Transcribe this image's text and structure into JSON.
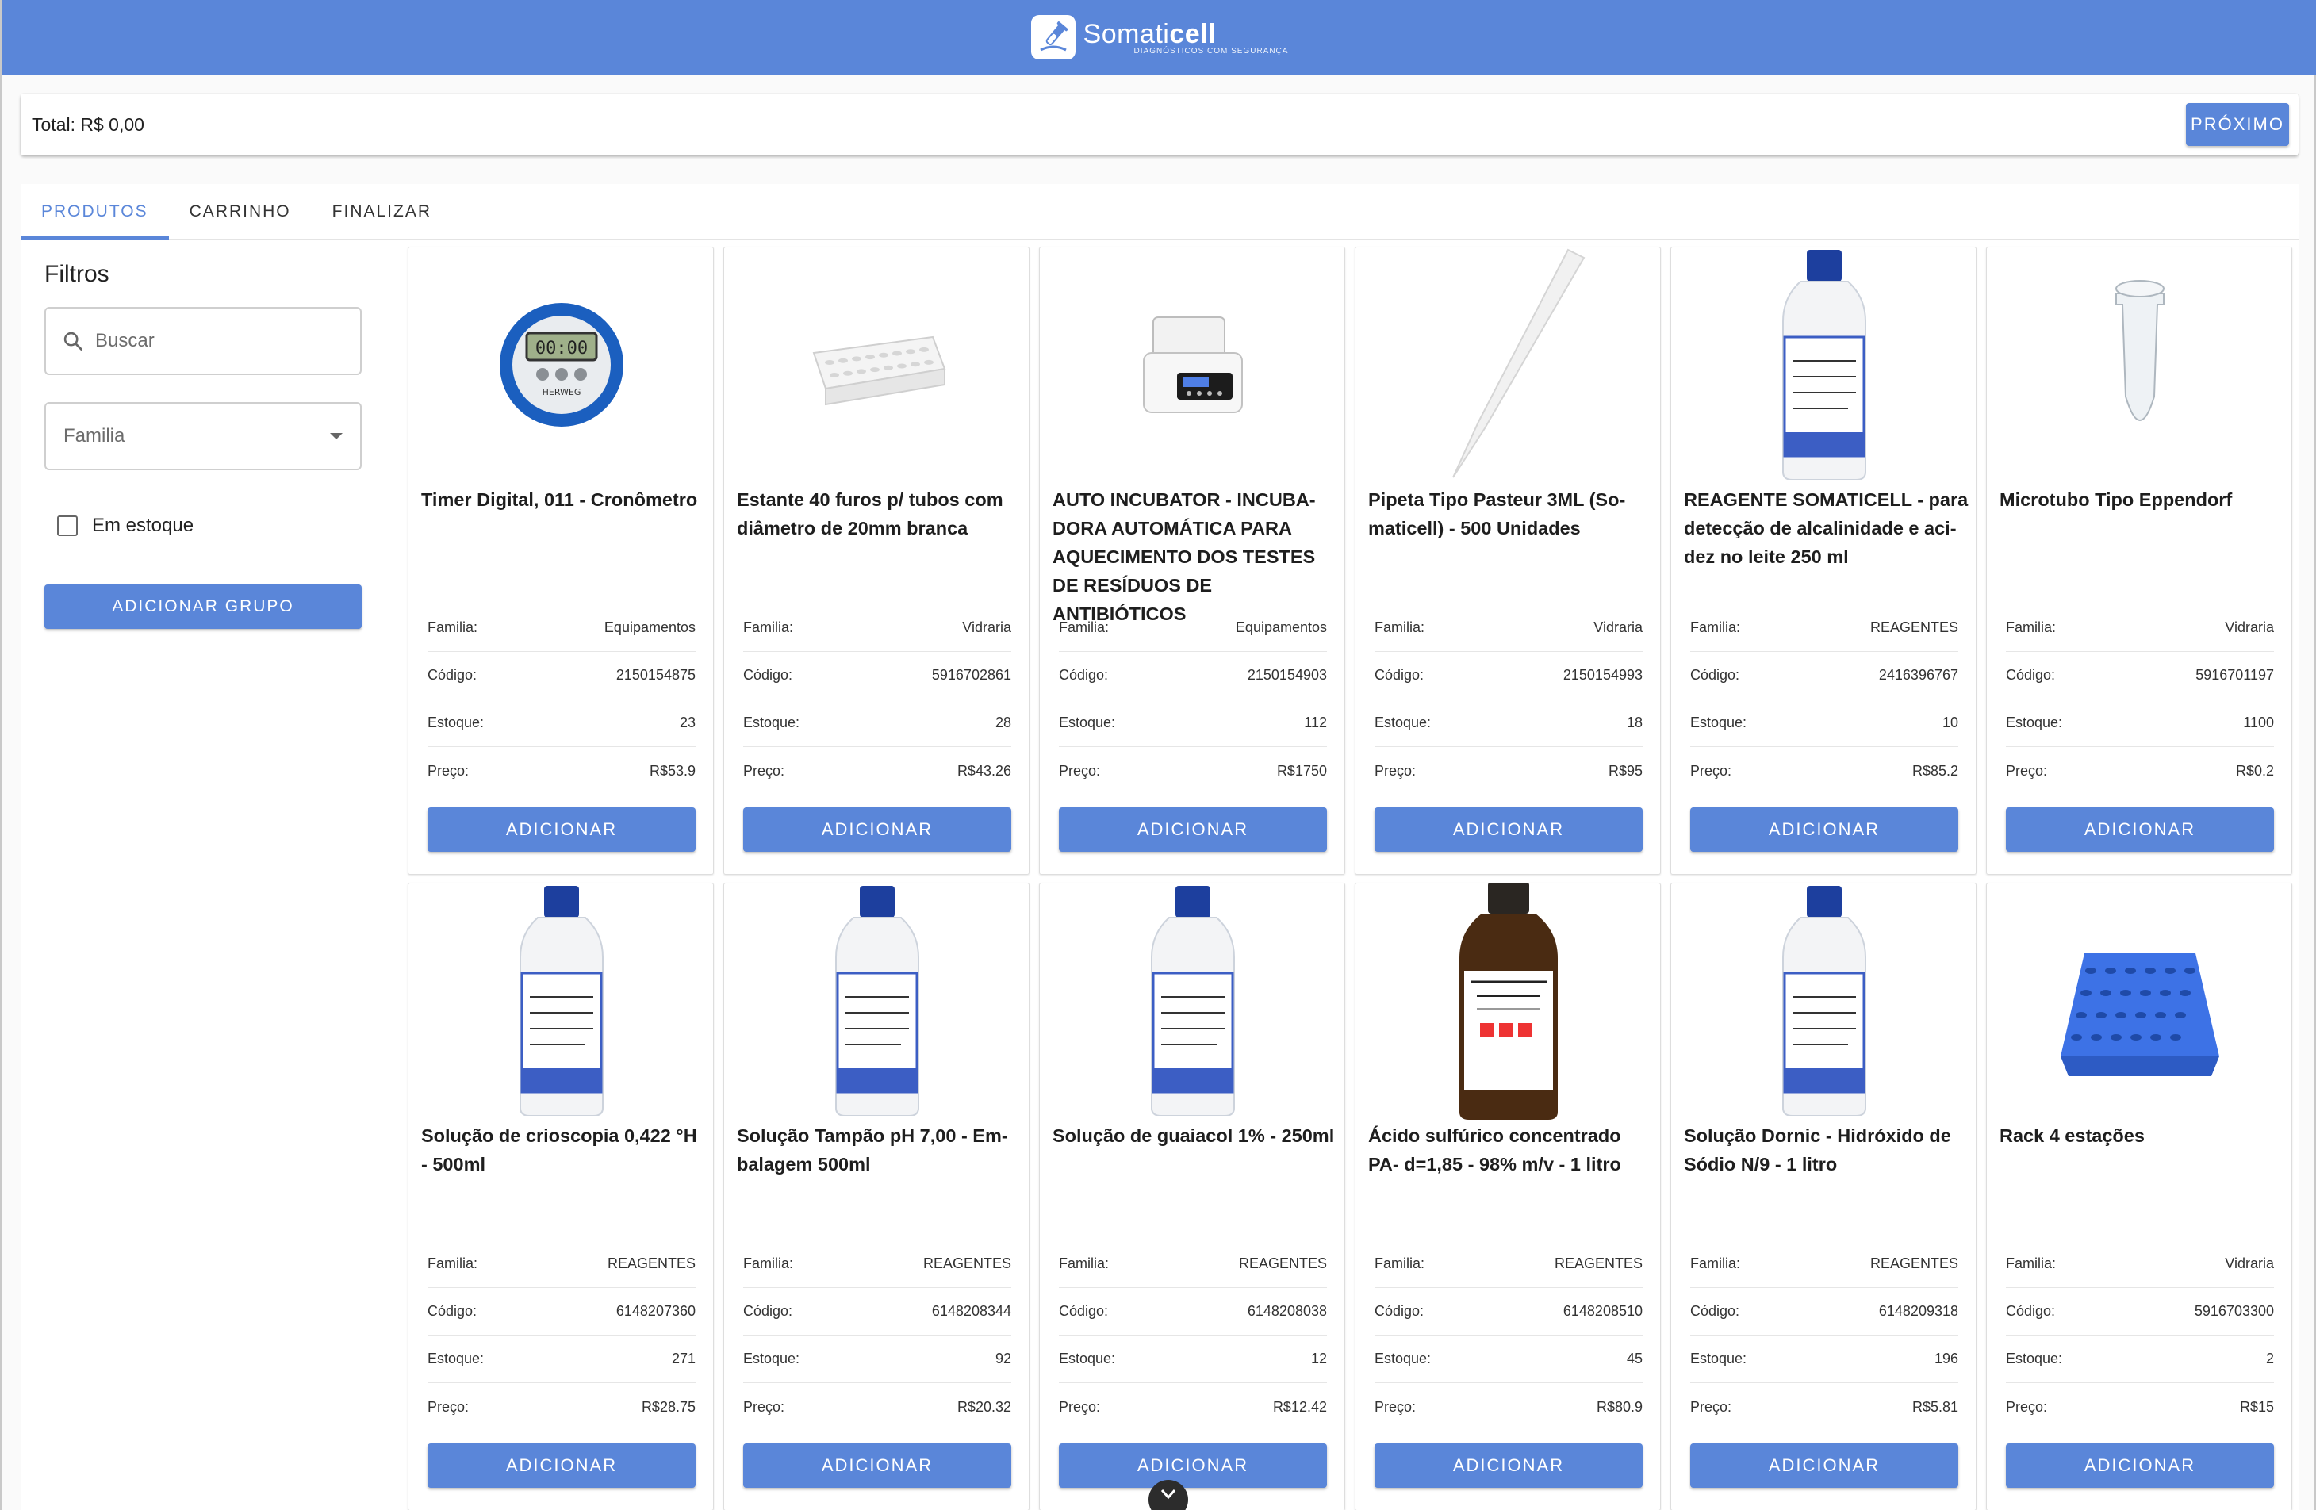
{
  "header": {
    "brand_name_light": "Somati",
    "brand_name_bold": "cell",
    "brand_tagline": "DIAGNÓSTICOS COM SEGURANÇA",
    "brand_color": "#5a86d9"
  },
  "totalbar": {
    "total_label": "Total: R$ 0,00",
    "next_button": "PRÓXIMO"
  },
  "tabs": [
    {
      "label": "PRODUTOS",
      "active": true
    },
    {
      "label": "CARRINHO",
      "active": false
    },
    {
      "label": "FINALIZAR",
      "active": false
    }
  ],
  "filters": {
    "title": "Filtros",
    "search_placeholder": "Buscar",
    "family_placeholder": "Familia",
    "in_stock_label": "Em estoque",
    "in_stock_checked": false,
    "add_group_button": "ADICIONAR GRUPO"
  },
  "labels": {
    "family": "Familia:",
    "code": "Código:",
    "stock": "Estoque:",
    "price": "Preço:",
    "add_button": "ADICIONAR"
  },
  "products": [
    {
      "title": "Timer Digital, 011 - Cronômetro",
      "family": "Equipamentos",
      "code": "2150154875",
      "stock": "23",
      "price": "R$53.9",
      "icon": "timer-icon"
    },
    {
      "title": "Estante 40 furos p/ tubos com diâmetro de 20mm branca",
      "family": "Vidraria",
      "code": "5916702861",
      "stock": "28",
      "price": "R$43.26",
      "icon": "tube-rack-icon"
    },
    {
      "title": "AUTO INCUBATOR - INCUBA-DORA AUTOMÁTICA PARA AQUECIMENTO DOS TESTES DE RESÍDUOS DE ANTIBIÓTICOS",
      "family": "Equipamentos",
      "code": "2150154903",
      "stock": "112",
      "price": "R$1750",
      "icon": "incubator-icon"
    },
    {
      "title": "Pipeta Tipo Pasteur 3ML (So-maticell) - 500 Unidades",
      "family": "Vidraria",
      "code": "2150154993",
      "stock": "18",
      "price": "R$95",
      "icon": "pipette-icon"
    },
    {
      "title": "REAGENTE SOMATICELL - para detecção de alcalinidade e aci-dez no leite 250 ml",
      "family": "REAGENTES",
      "code": "2416396767",
      "stock": "10",
      "price": "R$85.2",
      "icon": "bottle-icon"
    },
    {
      "title": "Microtubo Tipo Eppendorf",
      "family": "Vidraria",
      "code": "5916701197",
      "stock": "1100",
      "price": "R$0.2",
      "icon": "microtube-icon"
    },
    {
      "title": "Solução de crioscopia 0,422 °H - 500ml",
      "family": "REAGENTES",
      "code": "6148207360",
      "stock": "271",
      "price": "R$28.75",
      "icon": "bottle-icon"
    },
    {
      "title": "Solução Tampão pH 7,00 - Em-balagem 500ml",
      "family": "REAGENTES",
      "code": "6148208344",
      "stock": "92",
      "price": "R$20.32",
      "icon": "bottle-icon"
    },
    {
      "title": "Solução de guaiacol 1% - 250ml",
      "family": "REAGENTES",
      "code": "6148208038",
      "stock": "12",
      "price": "R$12.42",
      "icon": "bottle-icon"
    },
    {
      "title": "Ácido sulfúrico concentrado PA- d=1,85 - 98% m/v - 1 litro",
      "family": "REAGENTES",
      "code": "6148208510",
      "stock": "45",
      "price": "R$80.9",
      "icon": "amber-bottle-icon"
    },
    {
      "title": "Solução Dornic - Hidróxido de Sódio N/9 - 1 litro",
      "family": "REAGENTES",
      "code": "6148209318",
      "stock": "196",
      "price": "R$5.81",
      "icon": "bottle-icon"
    },
    {
      "title": "Rack 4 estações",
      "family": "Vidraria",
      "code": "5916703300",
      "stock": "2",
      "price": "R$15",
      "icon": "rack-icon"
    }
  ]
}
